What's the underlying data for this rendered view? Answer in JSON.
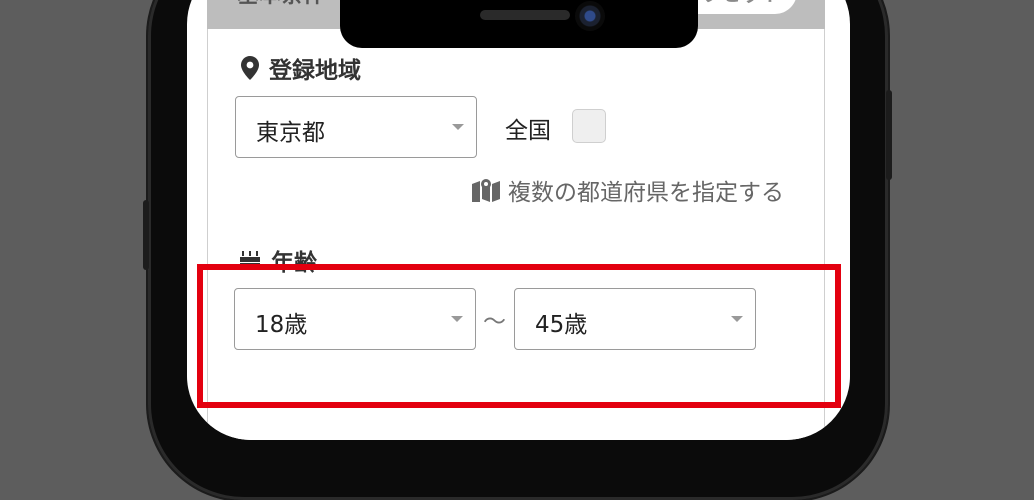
{
  "header": {
    "title": "基本条件",
    "reset_label": "リセット"
  },
  "region": {
    "label": "登録地域",
    "icon": "map-pin-icon",
    "selected": "東京都",
    "nationwide_label": "全国",
    "nationwide_checked": false,
    "multi_link": "複数の都道府県を指定する",
    "multi_icon": "map-icon"
  },
  "age": {
    "label": "年齢",
    "icon": "birthday-cake-icon",
    "min": "18歳",
    "separator": "〜",
    "max": "45歳"
  },
  "colors": {
    "highlight": "#e3000f",
    "header_bg": "#bdbdbd"
  }
}
